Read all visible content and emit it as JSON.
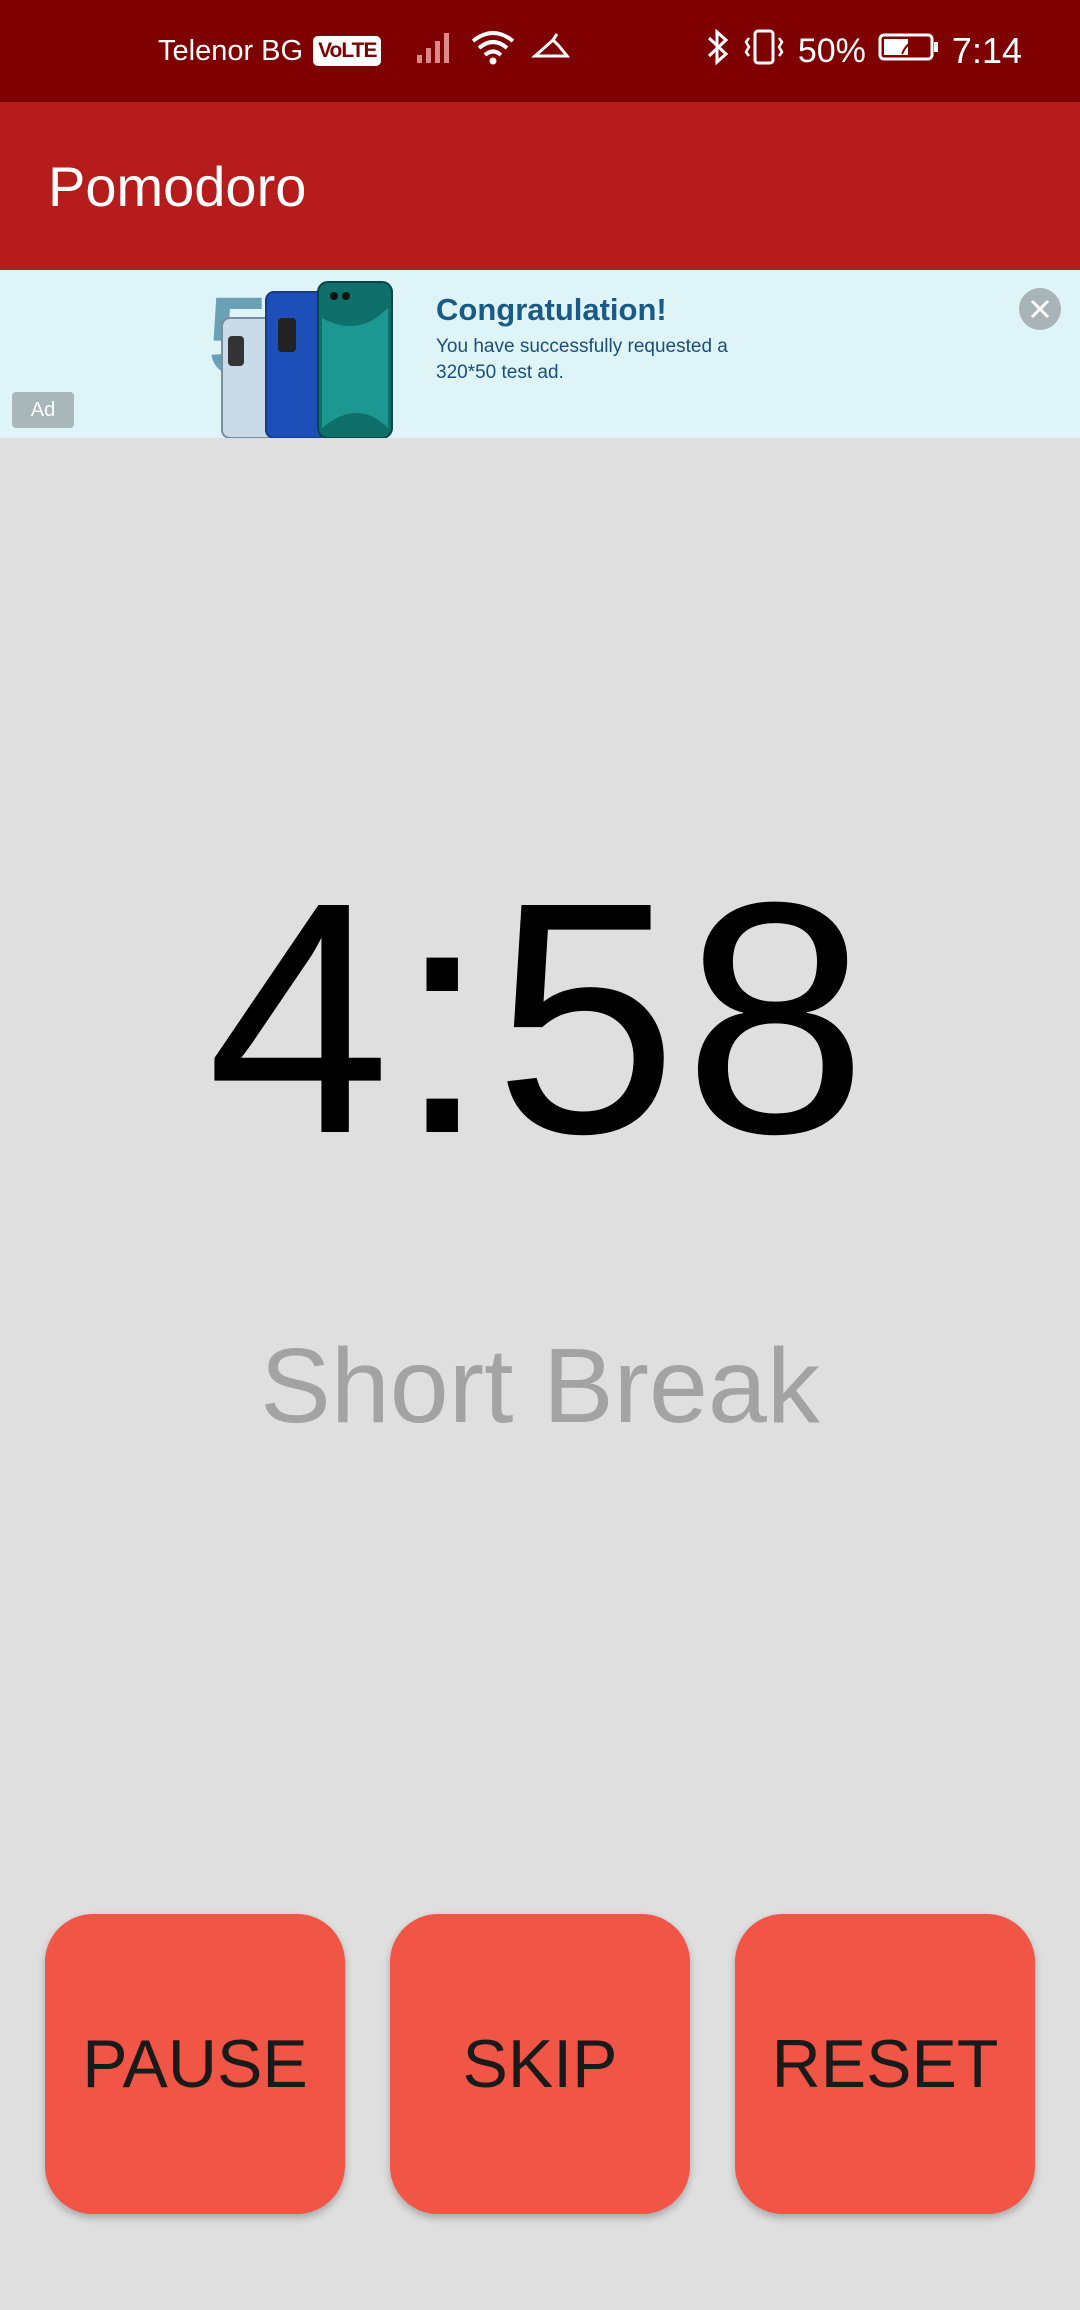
{
  "status_bar": {
    "carrier": "Telenor BG",
    "volte": "VoLTE",
    "battery_percent": "50%",
    "time": "7:14",
    "icons": [
      "signal-icon",
      "wifi-icon",
      "hotspot-icon",
      "bluetooth-icon",
      "vibrate-icon",
      "battery-icon"
    ]
  },
  "app_bar": {
    "title": "Pomodoro"
  },
  "ad": {
    "title": "Congratulation!",
    "line1": "You have successfully requested a",
    "line2": "320*50 test ad.",
    "label": "Ad"
  },
  "timer": {
    "display": "4:58",
    "mode": "Short Break"
  },
  "buttons": {
    "pause": "PAUSE",
    "skip": "SKIP",
    "reset": "RESET"
  },
  "colors": {
    "status_bar": "#7e0000",
    "app_bar": "#b71c1c",
    "button": "#f05545",
    "background": "#dfdfdf"
  }
}
